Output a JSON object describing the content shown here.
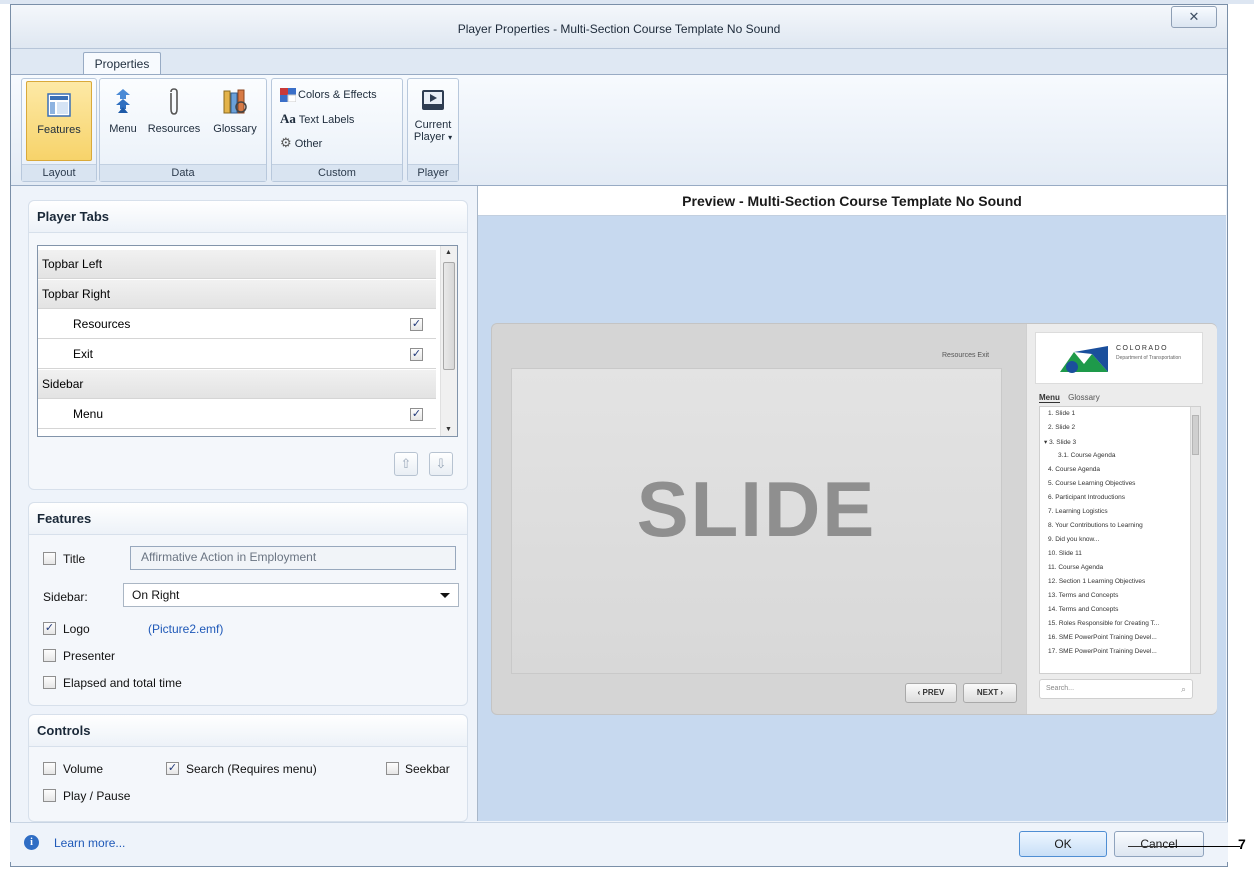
{
  "window": {
    "title": "Player Properties - Multi-Section Course Template No Sound",
    "close_label": "X"
  },
  "ribbon": {
    "tab": "Properties",
    "groups": {
      "layout": {
        "label": "Layout",
        "features": "Features"
      },
      "data": {
        "label": "Data",
        "menu": "Menu",
        "resources": "Resources",
        "glossary": "Glossary"
      },
      "custom": {
        "label": "Custom",
        "colors": "Colors & Effects",
        "text_labels_prefix": "Aa",
        "text_labels": "Text Labels",
        "other": "Other"
      },
      "player": {
        "label": "Player",
        "current": "Current",
        "player_btn": "Player"
      }
    }
  },
  "player_tabs": {
    "heading": "Player Tabs",
    "rows": [
      {
        "label": "Topbar Left",
        "type": "group"
      },
      {
        "label": "Topbar Right",
        "type": "group"
      },
      {
        "label": "Resources",
        "type": "item",
        "checked": true
      },
      {
        "label": "Exit",
        "type": "item",
        "checked": true
      },
      {
        "label": "Sidebar",
        "type": "group"
      },
      {
        "label": "Menu",
        "type": "item",
        "checked": true
      }
    ]
  },
  "features": {
    "heading": "Features",
    "title_label": "Title",
    "title_value": "Affirmative Action in Employment",
    "sidebar_label": "Sidebar:",
    "sidebar_value": "On Right",
    "logo_label": "Logo",
    "logo_link": "(Picture2.emf)",
    "presenter_label": "Presenter",
    "elapsed_label": "Elapsed and total time"
  },
  "controls": {
    "heading": "Controls",
    "volume": "Volume",
    "search": "Search (Requires menu)",
    "seekbar": "Seekbar",
    "play_pause": "Play / Pause"
  },
  "preview": {
    "heading": "Preview - Multi-Section Course Template No Sound",
    "top_links": "Resources   Exit",
    "slide_text": "SLIDE",
    "prev": "‹ PREV",
    "next": "NEXT ›",
    "logo_text": "COLORADO",
    "logo_sub": "Department of Transportation",
    "tab_menu": "Menu",
    "tab_glossary": "Glossary",
    "search_placeholder": "Search...",
    "menu_items": [
      "1. Slide 1",
      "2. Slide 2",
      "▾ 3. Slide 3",
      "3.1. Course Agenda",
      "4. Course Agenda",
      "5. Course Learning Objectives",
      "6. Participant Introductions",
      "7. Learning Logistics",
      "8. Your Contributions to Learning",
      "9. Did you know...",
      "10. Slide 11",
      "11. Course Agenda",
      "12. Section 1 Learning Objectives",
      "13. Terms and Concepts",
      "14. Terms and Concepts",
      "15. Roles Responsible for Creating T...",
      "16. SME PowerPoint Training Devel...",
      "17. SME PowerPoint Training Devel..."
    ]
  },
  "footer": {
    "learn_more": "Learn more...",
    "ok": "OK",
    "cancel": "Cancel"
  },
  "callout": "7"
}
